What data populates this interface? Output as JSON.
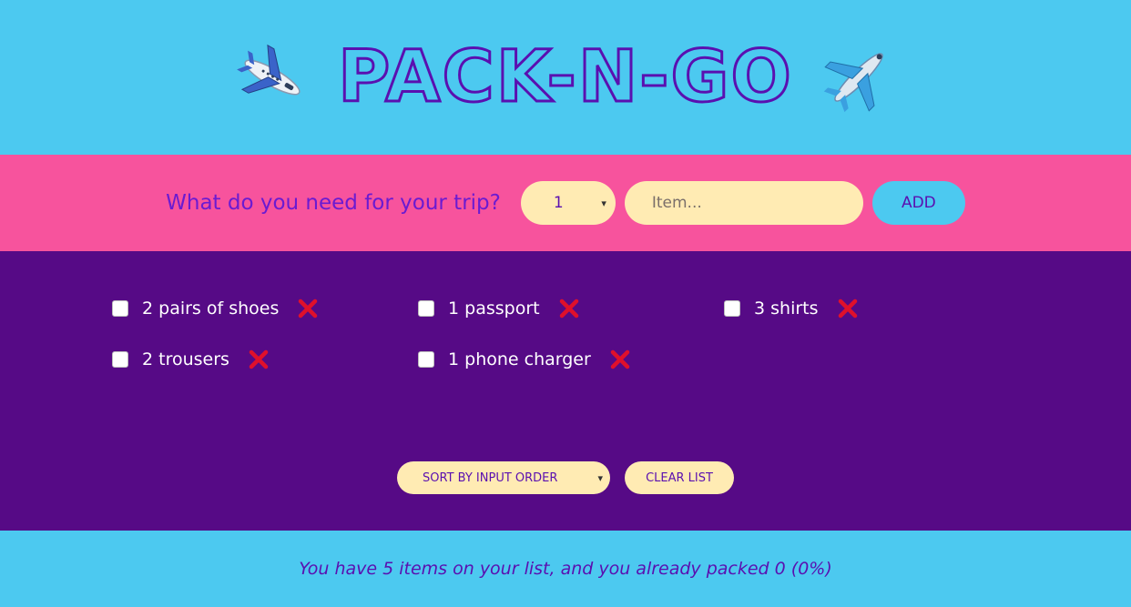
{
  "header": {
    "title": "PACK-N-GO",
    "left_icon": "airplane-departure-icon",
    "right_icon": "airplane-icon"
  },
  "form": {
    "question": "What do you need for your trip?",
    "quantity_selected": "1",
    "item_placeholder": "Item...",
    "add_label": "ADD"
  },
  "list": {
    "items": [
      {
        "label": "2 pairs of shoes",
        "packed": false
      },
      {
        "label": "1 passport",
        "packed": false
      },
      {
        "label": "3 shirts",
        "packed": false
      },
      {
        "label": "2 trousers",
        "packed": false
      },
      {
        "label": "1 phone charger",
        "packed": false
      }
    ],
    "delete_icon": "close-x-icon"
  },
  "actions": {
    "sort_selected": "SORT BY INPUT ORDER",
    "clear_label": "CLEAR LIST"
  },
  "stats": {
    "text": "You have 5 items on your list, and you already packed 0 (0%)"
  },
  "colors": {
    "header_bg": "#4cc9f0",
    "form_bg": "#f7539d",
    "list_bg": "#560a86",
    "accent_purple": "#5a10b0",
    "field_bg": "#ffebb3",
    "delete_red": "#e0102b"
  }
}
